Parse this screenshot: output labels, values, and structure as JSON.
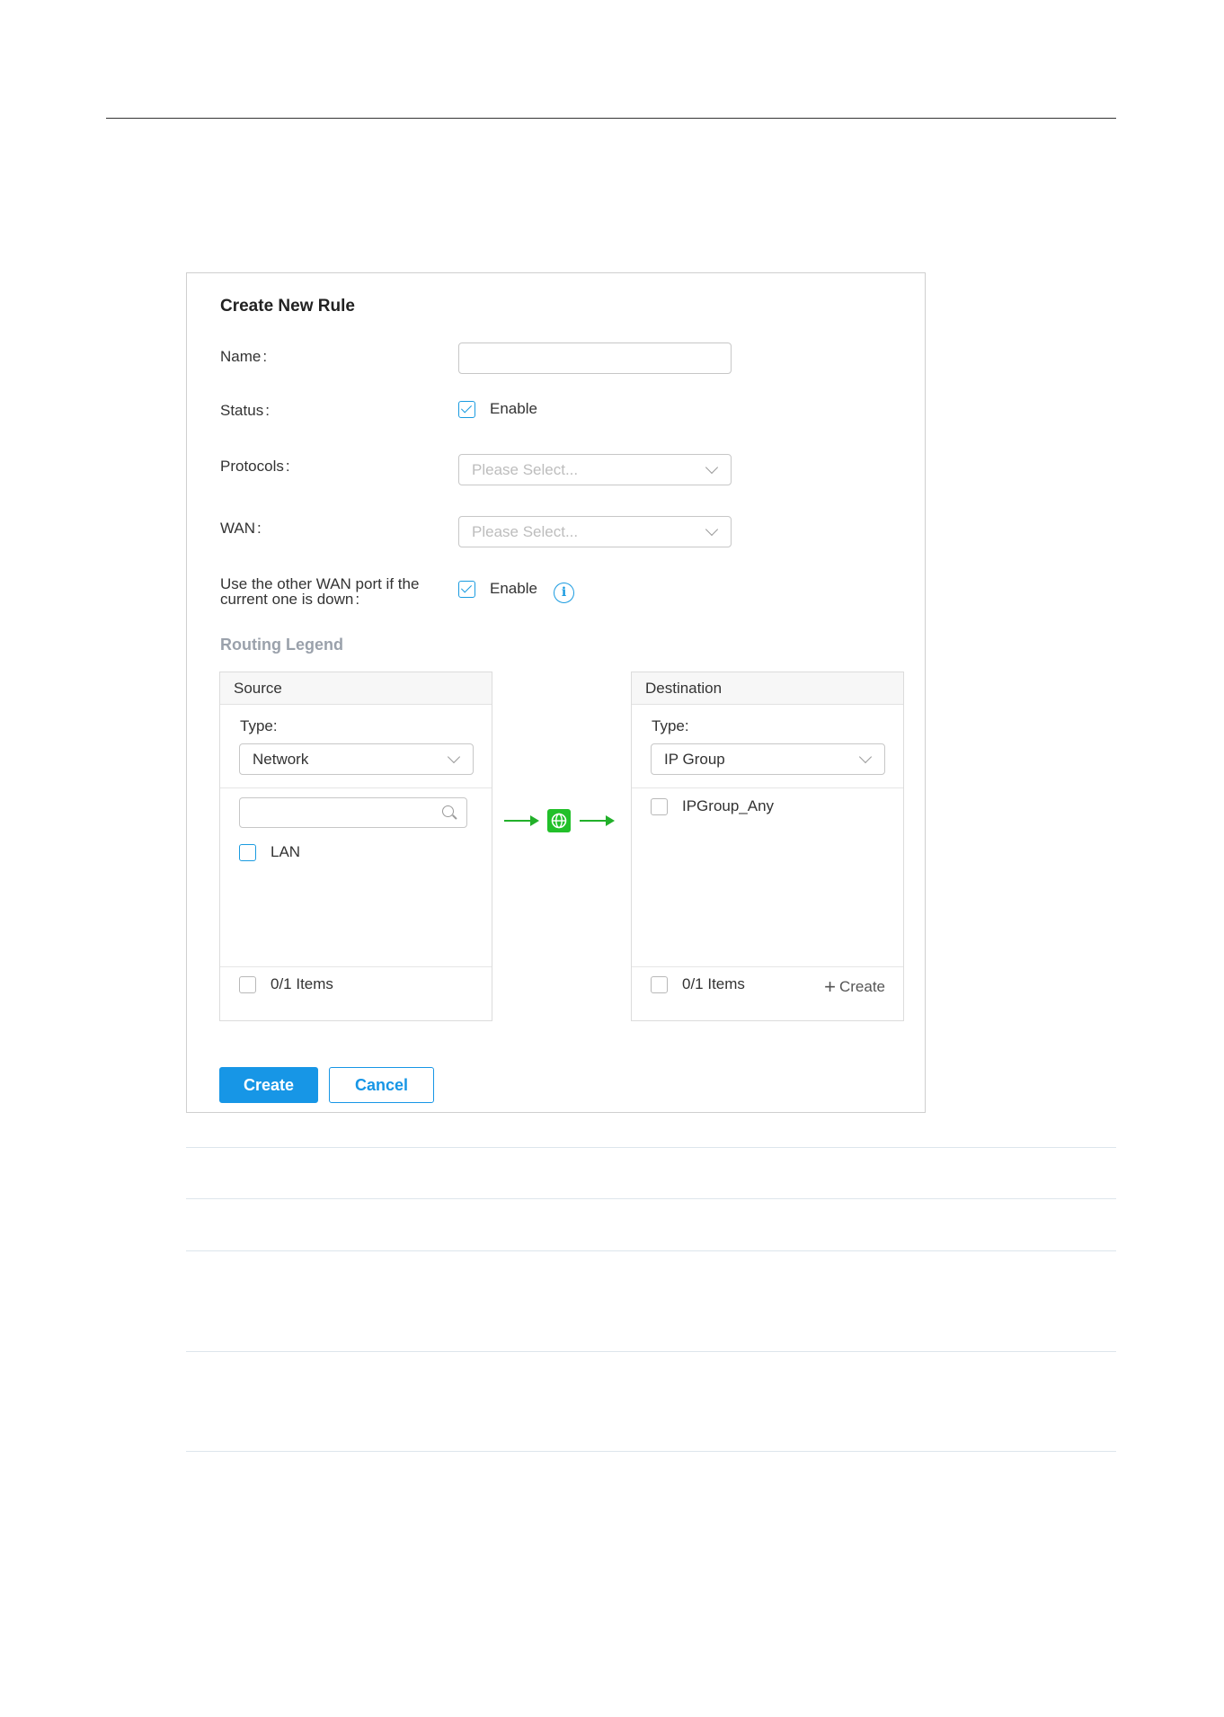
{
  "dialog": {
    "title": "Create New Rule",
    "name": {
      "label": "Name",
      "value": ""
    },
    "status": {
      "label": "Status",
      "checkbox_label": "Enable",
      "checked": true
    },
    "protocols": {
      "label": "Protocols",
      "placeholder": "Please Select..."
    },
    "wan": {
      "label": "WAN",
      "placeholder": "Please Select..."
    },
    "failover": {
      "label_line1": "Use the other WAN port if the",
      "label_line2": "current one is down",
      "checkbox_label": "Enable",
      "checked": true
    },
    "routing_legend": "Routing Legend",
    "source": {
      "header": "Source",
      "type_label": "Type",
      "type_value": "Network",
      "items": [
        {
          "label": "LAN",
          "checked": false
        }
      ],
      "count": "0/1 Items"
    },
    "destination": {
      "header": "Destination",
      "type_label": "Type",
      "type_value": "IP Group",
      "items": [
        {
          "label": "IPGroup_Any",
          "checked": false
        }
      ],
      "count": "0/1 Items",
      "create_label": "Create"
    },
    "buttons": {
      "create": "Create",
      "cancel": "Cancel"
    },
    "colon": ":"
  },
  "colors": {
    "accent": "#1796e6",
    "route": "#22b02a",
    "legend_title": "#9aa1ab"
  },
  "icons": [
    "chevron-down-icon",
    "check-icon",
    "info-icon",
    "search-icon",
    "globe-icon",
    "arrow-right-icon",
    "plus-icon"
  ]
}
